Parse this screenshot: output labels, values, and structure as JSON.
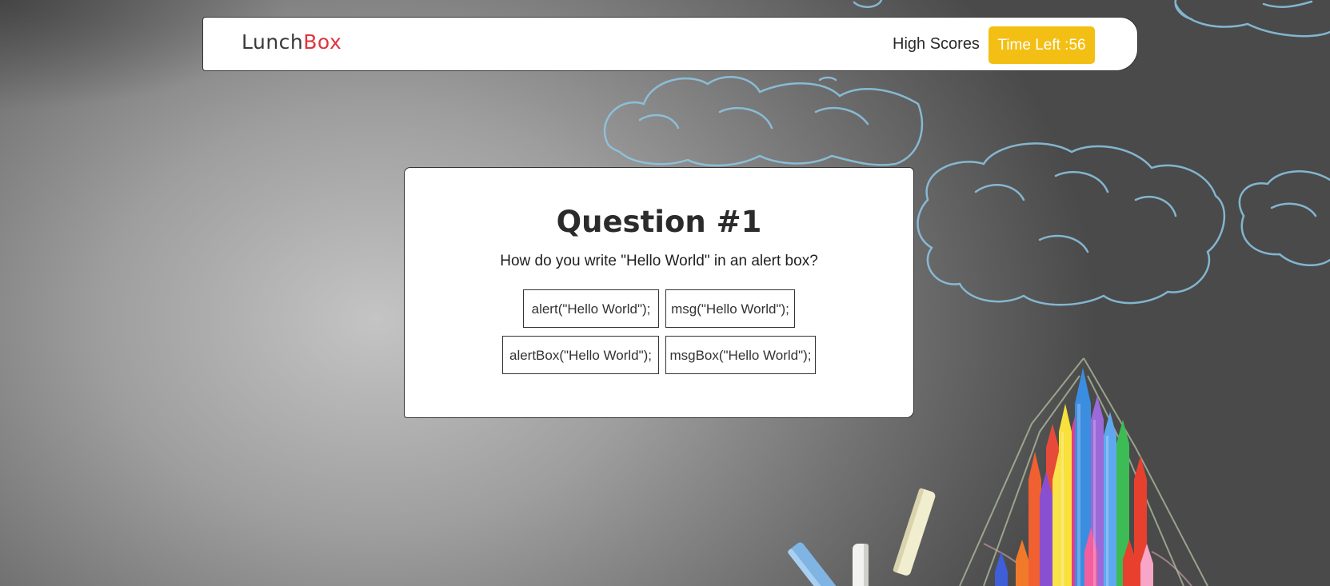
{
  "navbar": {
    "brand_part1": "Lunch",
    "brand_part2": "Box",
    "high_scores_label": "High Scores",
    "timer_label": "Time Left :56"
  },
  "quiz": {
    "title": "Question #1",
    "question": "How do you write \"Hello World\" in an alert box?",
    "answers": [
      "alert(\"Hello World\");",
      "msg(\"Hello World\");",
      "alertBox(\"Hello World\");",
      "msgBox(\"Hello World\");"
    ]
  },
  "colors": {
    "brand_accent": "#e0343f",
    "timer_bg": "#f3bf14",
    "chalk_blue": "#8ec8e6"
  },
  "decorations": {
    "background": "chalkboard",
    "items": [
      "chalk-cloud-drawings",
      "colored-crayons",
      "chalk-sticks"
    ]
  }
}
